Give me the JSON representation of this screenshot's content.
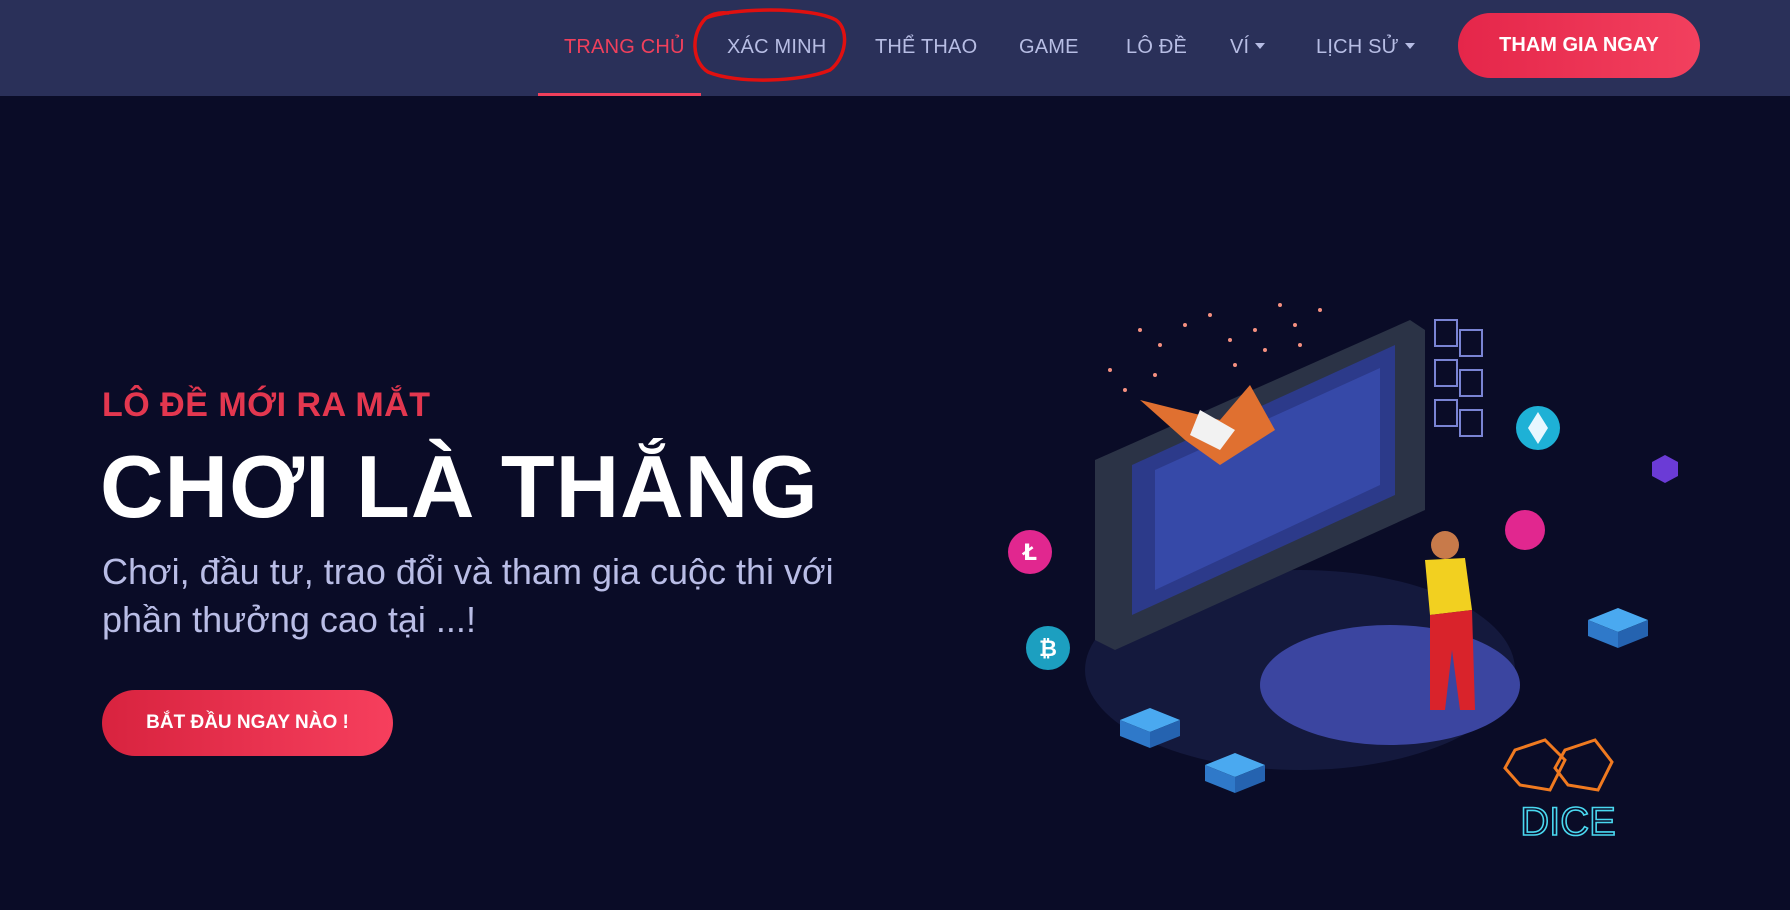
{
  "nav": {
    "items": [
      {
        "label": "TRANG CHỦ"
      },
      {
        "label": "XÁC MINH"
      },
      {
        "label": "THỂ THAO"
      },
      {
        "label": "GAME"
      },
      {
        "label": "LÔ ĐỀ"
      },
      {
        "label": "VÍ"
      },
      {
        "label": "LỊCH SỬ"
      }
    ],
    "active_index": 0,
    "cta_label": "THAM GIA NGAY"
  },
  "hero": {
    "eyebrow": "LÔ ĐỀ MỚI RA MẮT",
    "headline": "CHƠI LÀ THẮNG",
    "subtitle": "Chơi, đầu tư, trao đổi và tham gia cuộc thi với phần thưởng cao tại ...!",
    "button_label": "BẮT ĐẦU NGAY NÀO !",
    "illustration_text": "DICE"
  },
  "colors": {
    "navbar_bg": "#2a3059",
    "page_bg": "#0a0c27",
    "accent_red": "#e5264a",
    "nav_text": "#b7bde4",
    "annotation_red": "#e01010"
  }
}
